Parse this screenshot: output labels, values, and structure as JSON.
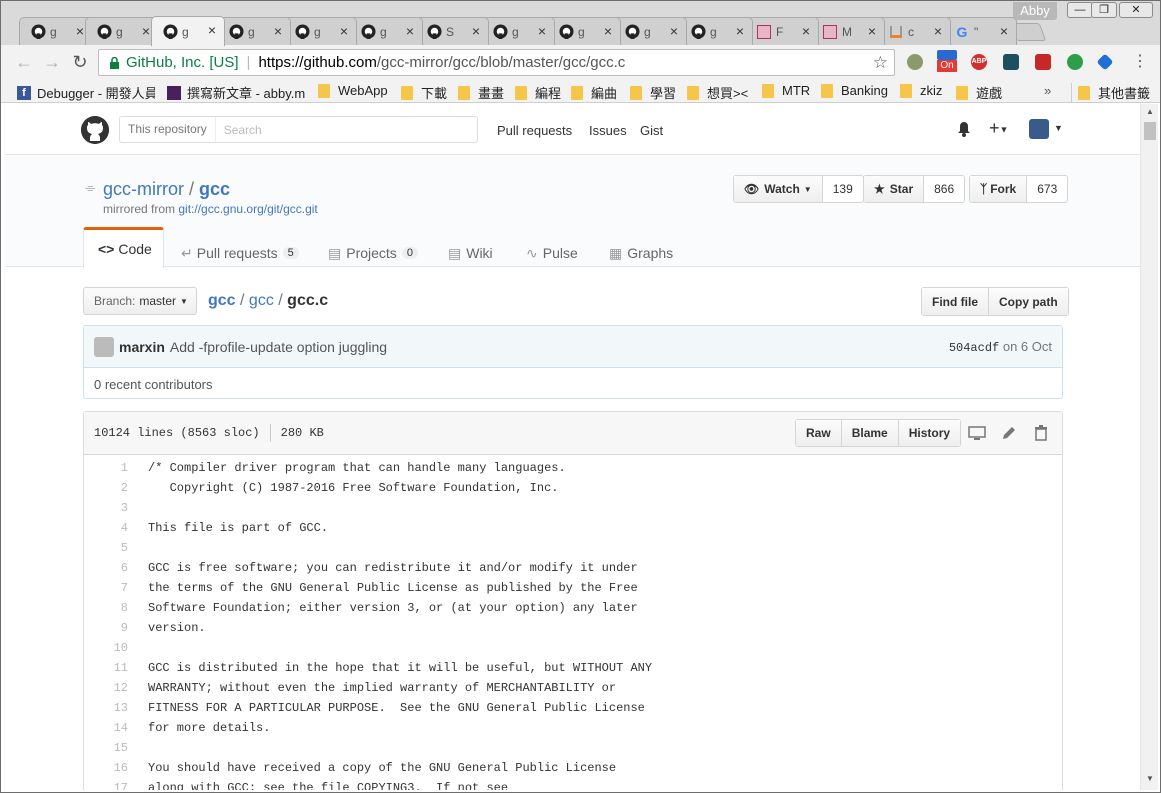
{
  "browser": {
    "profile_name": "Abby",
    "tabs": [
      {
        "icon": "github-icon",
        "title": "g"
      },
      {
        "icon": "github-icon",
        "title": "g"
      },
      {
        "icon": "github-icon",
        "title": "g"
      },
      {
        "icon": "github-icon",
        "title": "g"
      },
      {
        "icon": "github-icon",
        "title": "g"
      },
      {
        "icon": "github-icon",
        "title": "g"
      },
      {
        "icon": "github-icon",
        "title": "S"
      },
      {
        "icon": "github-icon",
        "title": "g"
      },
      {
        "icon": "github-icon",
        "title": "g"
      },
      {
        "icon": "github-icon",
        "title": "g"
      },
      {
        "icon": "github-icon",
        "title": "g"
      },
      {
        "icon": "gcc-icon",
        "title": "F"
      },
      {
        "icon": "gcc-icon",
        "title": "M"
      },
      {
        "icon": "stackoverflow-icon",
        "title": "c"
      },
      {
        "icon": "google-icon",
        "title": "\""
      }
    ],
    "active_tab_index": 2,
    "omnibox": {
      "secure_label": "GitHub, Inc. [US]",
      "url_scheme_host": "https://github.com",
      "url_path": "/gcc-mirror/gcc/blob/master/gcc/gcc.c"
    },
    "bookmarks": [
      {
        "label": "Debugger - 開發人員",
        "icon": "facebook-icon"
      },
      {
        "label": "撰寫新文章 - abby.m",
        "icon": "ab-icon"
      },
      {
        "label": "WebApp",
        "icon": "folder-icon"
      },
      {
        "label": "下載",
        "icon": "folder-icon"
      },
      {
        "label": "畫畫",
        "icon": "folder-icon"
      },
      {
        "label": "編程",
        "icon": "folder-icon"
      },
      {
        "label": "編曲",
        "icon": "folder-icon"
      },
      {
        "label": "學習",
        "icon": "folder-icon"
      },
      {
        "label": "想買><",
        "icon": "folder-icon"
      },
      {
        "label": "MTR",
        "icon": "folder-icon"
      },
      {
        "label": "Banking",
        "icon": "folder-icon"
      },
      {
        "label": "zkiz",
        "icon": "folder-icon"
      },
      {
        "label": "遊戲",
        "icon": "folder-icon"
      }
    ],
    "bookmarks_overflow": "»",
    "other_bookmarks": "其他書籤",
    "extension_on_label": "On",
    "extension_abp_label": "ABP"
  },
  "github": {
    "search_scope": "This repository",
    "search_placeholder": "Search",
    "nav": [
      "Pull requests",
      "Issues",
      "Gist"
    ],
    "repo_owner": "gcc-mirror",
    "repo_separator": "/",
    "repo_name": "gcc",
    "mirrored_from_label": "mirrored from",
    "mirrored_from_url": "git://gcc.gnu.org/git/gcc.git",
    "watch_label": "Watch",
    "watch_count": "139",
    "star_label": "Star",
    "star_count": "866",
    "fork_label": "Fork",
    "fork_count": "673",
    "tabs": [
      {
        "label": "Code",
        "count": ""
      },
      {
        "label": "Pull requests",
        "count": "5"
      },
      {
        "label": "Projects",
        "count": "0"
      },
      {
        "label": "Wiki",
        "count": ""
      },
      {
        "label": "Pulse",
        "count": ""
      },
      {
        "label": "Graphs",
        "count": ""
      }
    ],
    "branch_label": "Branch:",
    "branch_name": "master",
    "breadcrumb": {
      "repo": "gcc",
      "dir": "gcc",
      "file": "gcc.c"
    },
    "find_file": "Find file",
    "copy_path": "Copy path",
    "commit": {
      "author": "marxin",
      "message": "Add -fprofile-update option juggling",
      "sha": "504acdf",
      "date": "on 6 Oct"
    },
    "contributors": "0 recent contributors",
    "file_info": {
      "lines": "10124 lines (8563 sloc)",
      "size": "280 KB"
    },
    "file_buttons": [
      "Raw",
      "Blame",
      "History"
    ],
    "code_lines": [
      "/* Compiler driver program that can handle many languages.",
      "   Copyright (C) 1987-2016 Free Software Foundation, Inc.",
      "",
      "This file is part of GCC.",
      "",
      "GCC is free software; you can redistribute it and/or modify it under",
      "the terms of the GNU General Public License as published by the Free",
      "Software Foundation; either version 3, or (at your option) any later",
      "version.",
      "",
      "GCC is distributed in the hope that it will be useful, but WITHOUT ANY",
      "WARRANTY; without even the implied warranty of MERCHANTABILITY or",
      "FITNESS FOR A PARTICULAR PURPOSE.  See the GNU General Public License",
      "for more details.",
      "",
      "You should have received a copy of the GNU General Public License",
      "along with GCC; see the file COPYING3.  If not see"
    ]
  }
}
